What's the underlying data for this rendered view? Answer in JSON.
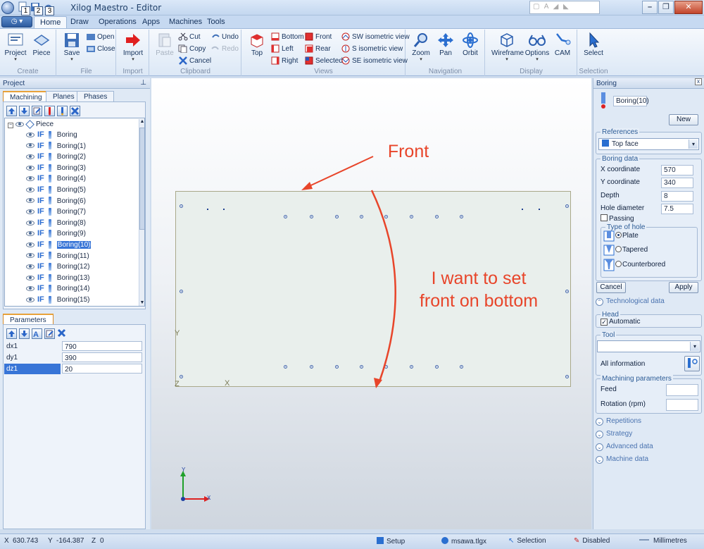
{
  "window": {
    "title": "Xilog Maestro - Editor",
    "quick_access": [
      "1",
      "2",
      "3"
    ],
    "search": "A"
  },
  "tabs": [
    "Home",
    "Draw",
    "Operations",
    "Apps",
    "Machines",
    "Tools"
  ],
  "ribbon": {
    "create": {
      "label": "Create",
      "project": "Project",
      "piece": "Piece"
    },
    "file": {
      "label": "File",
      "save": "Save",
      "open": "Open",
      "close": "Close"
    },
    "import": {
      "label": "Import",
      "import": "Import"
    },
    "clipboard": {
      "label": "Clipboard",
      "paste": "Paste",
      "cut": "Cut",
      "copy": "Copy",
      "cancel": "Cancel",
      "undo": "Undo",
      "redo": "Redo"
    },
    "views": {
      "label": "Views",
      "top": "Top",
      "bottom": "Bottom",
      "left": "Left",
      "right": "Right",
      "front": "Front",
      "rear": "Rear",
      "selected": "Selected",
      "sw": "SW isometric view",
      "s": "S isometric view",
      "se": "SE isometric view"
    },
    "navigation": {
      "label": "Navigation",
      "zoom": "Zoom",
      "pan": "Pan",
      "orbit": "Orbit"
    },
    "display": {
      "label": "Display",
      "wireframe": "Wireframe",
      "options": "Options",
      "cam": "CAM"
    },
    "selection": {
      "label": "Selection",
      "select": "Select"
    }
  },
  "project_panel": {
    "title": "Project",
    "tabs": [
      "Machining",
      "Planes",
      "Phases"
    ],
    "root": "Piece",
    "if_label": "IF",
    "items": [
      "Boring",
      "Boring(1)",
      "Boring(2)",
      "Boring(3)",
      "Boring(4)",
      "Boring(5)",
      "Boring(6)",
      "Boring(7)",
      "Boring(8)",
      "Boring(9)",
      "Boring(10)",
      "Boring(11)",
      "Boring(12)",
      "Boring(13)",
      "Boring(14)",
      "Boring(15)"
    ],
    "selected": "Boring(10)"
  },
  "parameters": {
    "tab": "Parameters",
    "rows": [
      {
        "key": "dx1",
        "value": "790"
      },
      {
        "key": "dy1",
        "value": "390"
      },
      {
        "key": "dz1",
        "value": "20"
      }
    ]
  },
  "viewport": {
    "axis_y": "Y",
    "axis_x": "X",
    "axis_z": "Z",
    "triad_y": "Y",
    "triad_x": "X"
  },
  "annotations": {
    "front": "Front",
    "note_line1": "I want to set",
    "note_line2": "front on bottom",
    "color": "#e8452a"
  },
  "boring_panel": {
    "title": "Boring",
    "name": "Boring(10)",
    "new": "New",
    "references_label": "References",
    "reference": "Top face",
    "boring_data_label": "Boring data",
    "x_label": "X coordinate",
    "x": "570",
    "y_label": "Y coordinate",
    "y": "340",
    "depth_label": "Depth",
    "depth": "8",
    "diam_label": "Hole diameter",
    "diam": "7.5",
    "passing": "Passing",
    "type_label": "Type of hole",
    "types": [
      "Plate",
      "Tapered",
      "Counterbored"
    ],
    "type_selected": "Plate",
    "cancel": "Cancel",
    "apply": "Apply",
    "tech": "Technological data",
    "head_label": "Head",
    "automatic": "Automatic",
    "tool_label": "Tool",
    "all_info": "All information",
    "mach_label": "Machining parameters",
    "feed": "Feed",
    "rotation": "Rotation (rpm)",
    "sections": [
      "Repetitions",
      "Strategy",
      "Advanced data",
      "Machine data"
    ]
  },
  "status": {
    "x_label": "X",
    "x": "630.743",
    "y_label": "Y",
    "y": "-164.387",
    "z_label": "Z",
    "z": "0",
    "setup": "Setup",
    "file": "msawa.tlgx",
    "selection": "Selection",
    "disabled": "Disabled",
    "units": "Millimetres"
  }
}
